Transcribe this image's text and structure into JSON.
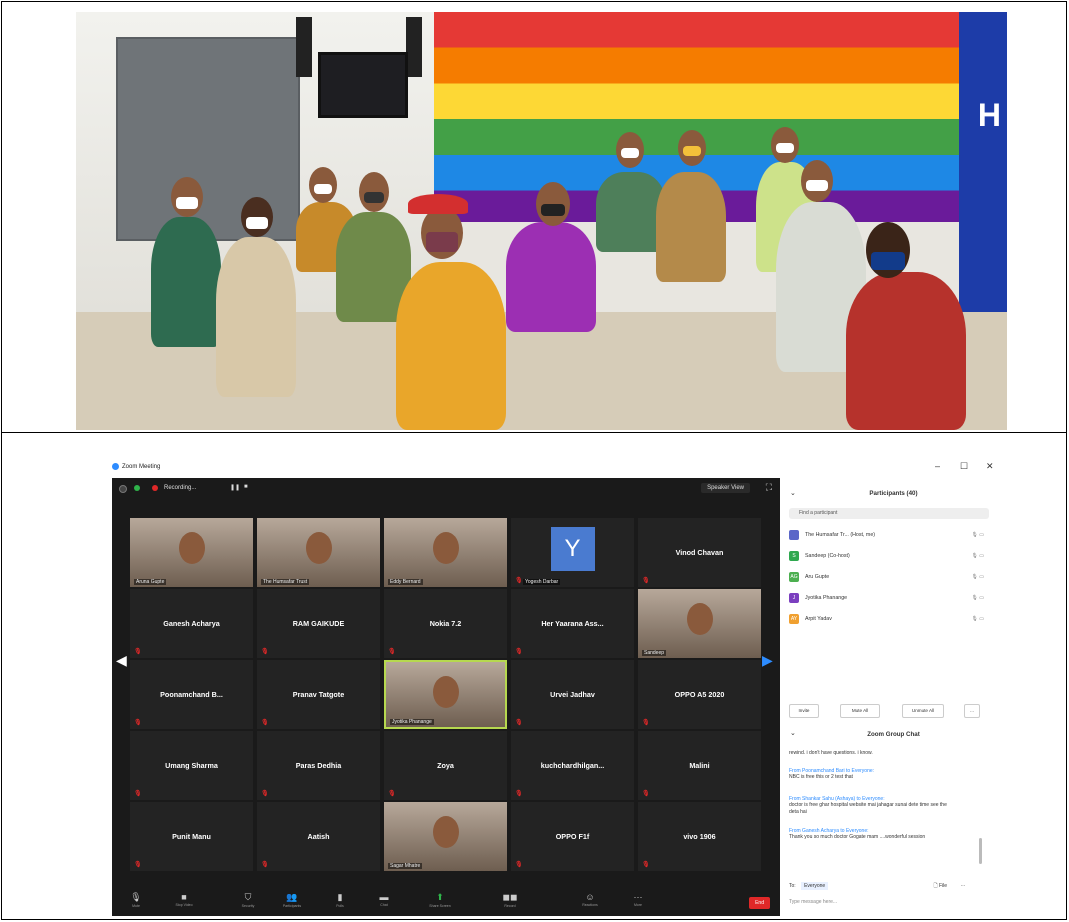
{
  "zoom": {
    "window_title": "Zoom Meeting",
    "recording_label": "Recording...",
    "speaker_view_label": "Speaker View",
    "window_controls": {
      "min": "–",
      "max": "☐",
      "close": "✕"
    }
  },
  "tiles": [
    {
      "name": "Aruna Gupte",
      "video": true
    },
    {
      "name": "The Humsafar Trust",
      "video": true
    },
    {
      "name": "Eddy Bernard",
      "video": true
    },
    {
      "name": "Yogesh Darbar",
      "avatar_letter": "Y"
    },
    {
      "name": "Vinod Chavan"
    },
    {
      "name": "Ganesh Acharya"
    },
    {
      "name": "RAM GAIKUDE"
    },
    {
      "name": "Nokia 7.2"
    },
    {
      "name": "Her Yaarana Ass..."
    },
    {
      "name": "Sandeep",
      "video": true
    },
    {
      "name": "Poonamchand B..."
    },
    {
      "name": "Pranav Tatgote"
    },
    {
      "name": "Jyotika Phanange",
      "video": true,
      "active": true
    },
    {
      "name": "Urvei Jadhav"
    },
    {
      "name": "OPPO A5 2020"
    },
    {
      "name": "Umang Sharma"
    },
    {
      "name": "Paras Dedhia"
    },
    {
      "name": "Zoya"
    },
    {
      "name": "kuchchardhilgan..."
    },
    {
      "name": "Malini"
    },
    {
      "name": "Punit Manu"
    },
    {
      "name": "Aatish"
    },
    {
      "name": "Sagar Mhatre",
      "video": true
    },
    {
      "name": "OPPO F1f"
    },
    {
      "name": "vivo 1906"
    }
  ],
  "toolbar": [
    {
      "icon": "microphone-icon",
      "glyph": "🎙",
      "label": "Mute"
    },
    {
      "icon": "video-camera-icon",
      "glyph": "■",
      "label": "Stop Video"
    },
    {
      "icon": "security-shield-icon",
      "glyph": "⛉",
      "label": "Security"
    },
    {
      "icon": "participants-icon",
      "glyph": "👥",
      "label": "Participants"
    },
    {
      "icon": "polls-icon",
      "glyph": "▮",
      "label": "Polls"
    },
    {
      "icon": "chat-icon",
      "glyph": "▬",
      "label": "Chat"
    },
    {
      "icon": "share-screen-icon",
      "glyph": "⬆",
      "label": "Share Screen"
    },
    {
      "icon": "record-icon",
      "glyph": "◼◼",
      "label": "Record"
    },
    {
      "icon": "reactions-icon",
      "glyph": "☺",
      "label": "Reactions"
    },
    {
      "icon": "more-icon",
      "glyph": "···",
      "label": "More"
    }
  ],
  "end_label": "End",
  "participants": {
    "header": "Participants (40)",
    "search_placeholder": "Find a participant",
    "rows": [
      {
        "initials": "",
        "color": "#5b67c8",
        "name": "The Humsafar Tr... (Host, me)"
      },
      {
        "initials": "S",
        "color": "#2fa84f",
        "name": "Sandeep (Co-host)"
      },
      {
        "initials": "AG",
        "color": "#4caf50",
        "name": "Aru Gupte"
      },
      {
        "initials": "J",
        "color": "#7b3fbf",
        "name": "Jyotika Phanange"
      },
      {
        "initials": "AY",
        "color": "#f0a030",
        "name": "Arpit Yadav"
      }
    ],
    "buttons": {
      "invite": "Invite",
      "mute_all": "Mute All",
      "unmute_all": "Unmute All",
      "more": "..."
    }
  },
  "chat": {
    "header": "Zoom Group Chat",
    "messages": [
      {
        "from": "",
        "text": "rewind. i don't have questions. i know."
      },
      {
        "from": "From Poonamchand Bari to Everyone:",
        "text": "NBC is free this or 2 test that"
      },
      {
        "from": "From Shankar Sahu (Ashaya) to Everyone:",
        "text": "doctor is free ghar hospital website mai jahagar sunai dete time see the deta hai"
      },
      {
        "from": "From Ganesh Acharya to Everyone:",
        "text": "Thank you so much doctor Gogate mam ....wonderful session"
      }
    ],
    "to_label": "To:",
    "to_value": "Everyone",
    "file_label": "File",
    "placeholder": "Type message here..."
  }
}
